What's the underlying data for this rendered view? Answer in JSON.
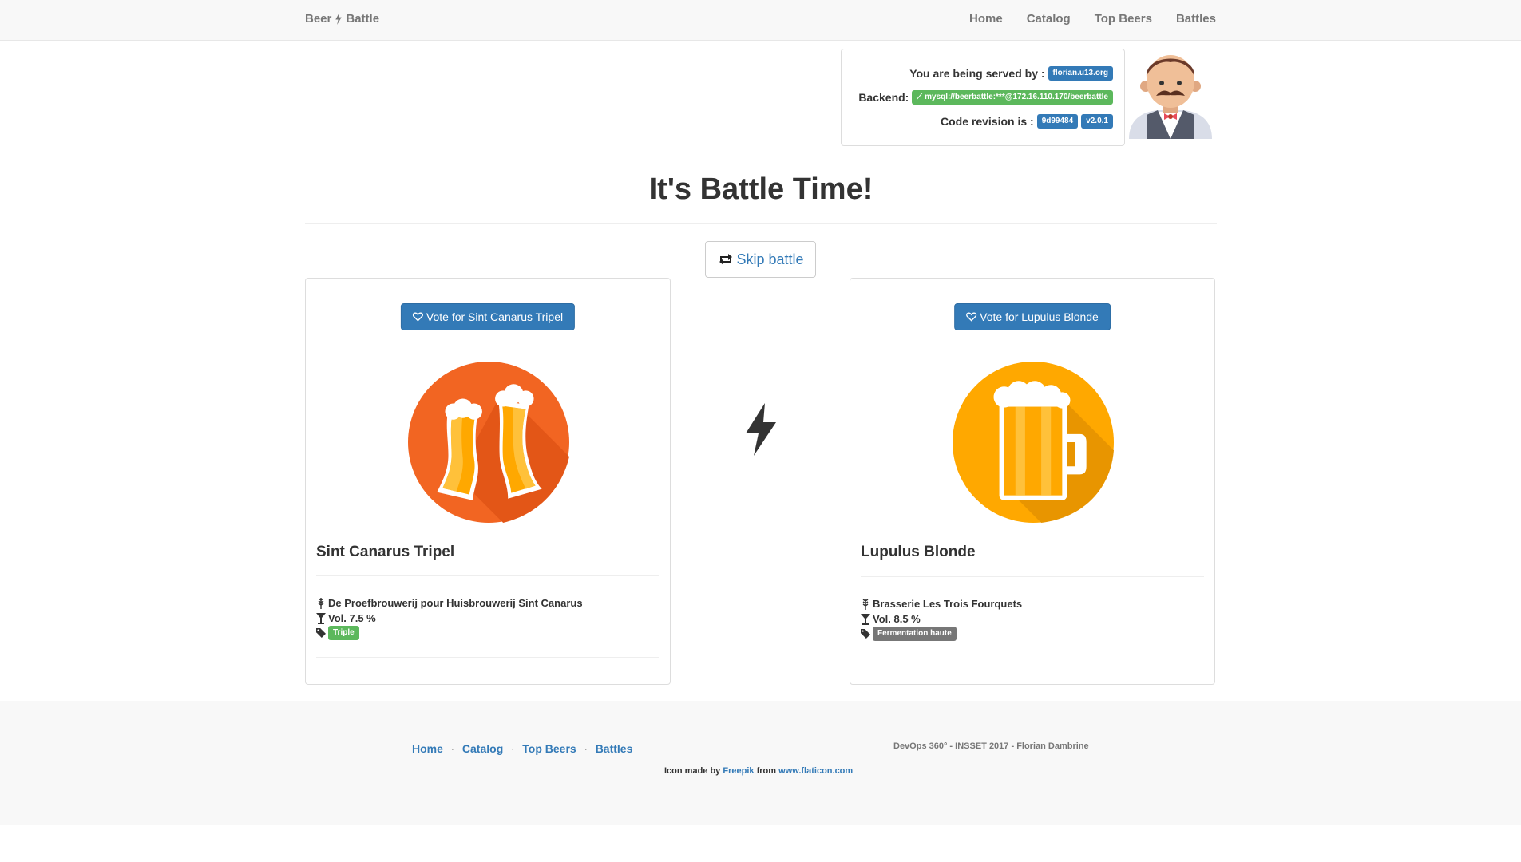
{
  "navbar": {
    "brand_left": "Beer",
    "brand_right": "Battle",
    "links": [
      "Home",
      "Catalog",
      "Top Beers",
      "Battles"
    ]
  },
  "server": {
    "served_label": "You are being served by :",
    "served_value": "florian.u13.org",
    "backend_label": "Backend:",
    "backend_value": "mysql://beerbattle:***@172.16.110.170/beerbattle",
    "revision_label": "Code revision is :",
    "revision_hash": "9d99484",
    "revision_version": "v2.0.1"
  },
  "battle": {
    "title": "It's Battle Time!",
    "skip_label": "Skip battle"
  },
  "beers": [
    {
      "vote_label": "Vote for Sint Canarus Tripel",
      "name": "Sint Canarus Tripel",
      "brewery": "De Proefbrouwerij pour Huisbrouwerij Sint Canarus",
      "abv": "Vol. 7.5 %",
      "tag": "Triple",
      "tag_color": "#5cb85c",
      "icon": "clinking-beer-glasses-icon",
      "icon_bg": "#f26522"
    },
    {
      "vote_label": "Vote for Lupulus Blonde",
      "name": "Lupulus Blonde",
      "brewery": "Brasserie Les Trois Fourquets",
      "abv": "Vol. 8.5 %",
      "tag": "Fermentation haute",
      "tag_color": "#777777",
      "icon": "beer-mug-icon",
      "icon_bg": "#ffa800"
    }
  ],
  "footer": {
    "links": [
      "Home",
      "Catalog",
      "Top Beers",
      "Battles"
    ],
    "credit_prefix": "Icon made by",
    "credit_author": "Freepik",
    "credit_from": "from",
    "credit_site": "www.flaticon.com",
    "copyright": "DevOps 360° - INSSET 2017 - Florian Dambrine"
  }
}
